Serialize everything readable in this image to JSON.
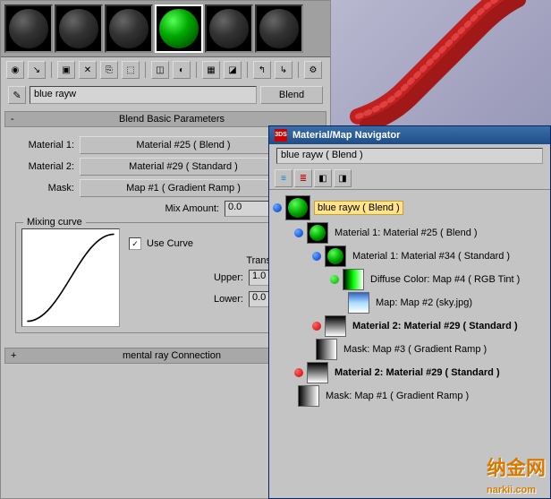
{
  "editor": {
    "name_field": "blue rayw",
    "type_button": "Blend",
    "rollout1_title": "Blend Basic Parameters",
    "rollout2_title": "mental ray Connection",
    "mat1_label": "Material 1:",
    "mat1_btn": "Material #25 ( Blend )",
    "mat2_label": "Material 2:",
    "mat2_btn": "Material #29 ( Standard )",
    "mask_label": "Mask:",
    "mask_btn": "Map #1 ( Gradient Ramp )",
    "mix_label": "Mix Amount:",
    "mix_value": "0.0",
    "mixgroup_legend": "Mixing curve",
    "usecurve_label": "Use Curve",
    "transition_label": "Transition zon",
    "upper_label": "Upper:",
    "upper_value": "1.0",
    "lower_label": "Lower:",
    "lower_value": "0.0"
  },
  "navigator": {
    "title": "Material/Map Navigator",
    "name_field": "blue rayw ( Blend )",
    "tree": {
      "n0": "blue rayw  ( Blend )",
      "n1": "Material 1: Material #25  ( Blend )",
      "n2": "Material 1: Material #34  ( Standard )",
      "n3": "Diffuse Color: Map #4  ( RGB Tint )",
      "n4": "Map: Map #2 (sky.jpg)",
      "n5": "Material 2: Material #29  ( Standard )",
      "n6": "Mask: Map #3  ( Gradient Ramp )",
      "n7": "Material 2: Material #29  ( Standard )",
      "n8": "Mask: Map #1  ( Gradient Ramp )"
    }
  },
  "watermark": {
    "text_cn": "纳金网",
    "text_en": "narkii.com"
  }
}
